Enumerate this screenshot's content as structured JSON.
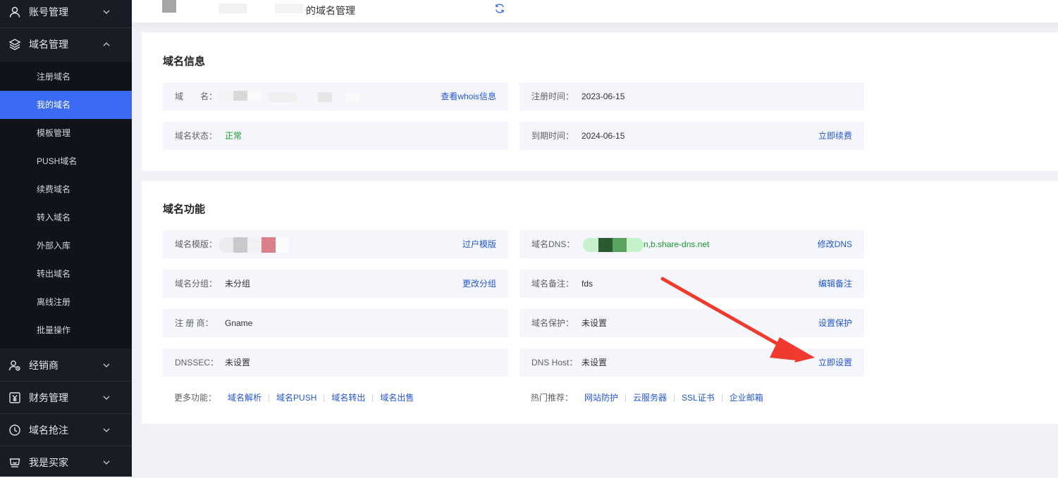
{
  "sidebar": {
    "groups": [
      {
        "label": "账号管理",
        "icon": "user-icon",
        "expanded": false
      },
      {
        "label": "域名管理",
        "icon": "layers-icon",
        "expanded": true
      },
      {
        "label": "经销商",
        "icon": "dealer-icon",
        "expanded": false
      },
      {
        "label": "财务管理",
        "icon": "finance-icon",
        "expanded": false
      },
      {
        "label": "域名抢注",
        "icon": "clock-icon",
        "expanded": false
      },
      {
        "label": "我是买家",
        "icon": "cart-icon",
        "expanded": false
      }
    ],
    "subitems": [
      {
        "label": "注册域名",
        "active": false
      },
      {
        "label": "我的域名",
        "active": true
      },
      {
        "label": "模板管理",
        "active": false
      },
      {
        "label": "PUSH域名",
        "active": false
      },
      {
        "label": "续费域名",
        "active": false
      },
      {
        "label": "转入域名",
        "active": false
      },
      {
        "label": "外部入库",
        "active": false
      },
      {
        "label": "转出域名",
        "active": false
      },
      {
        "label": "离线注册",
        "active": false
      },
      {
        "label": "批量操作",
        "active": false
      }
    ]
  },
  "header": {
    "title": "的域名管理",
    "refresh_icon": "refresh-icon"
  },
  "info_card": {
    "title": "域名信息",
    "domain_label": "域　　名：",
    "whois_link": "查看whois信息",
    "reg_time_label": "注册时间：",
    "reg_time_value": "2023-06-15",
    "status_label": "域名状态：",
    "status_value": "正常",
    "expire_label": "到期时间：",
    "expire_value": "2024-06-15",
    "renew_link": "立即续费"
  },
  "func_card": {
    "title": "域名功能",
    "template_label": "域名模版：",
    "template_link": "过户模版",
    "dns_label": "域名DNS：",
    "dns_value": "n,b.share-dns.net",
    "dns_link": "修改DNS",
    "group_label": "域名分组：",
    "group_value": "未分组",
    "group_link": "更改分组",
    "remark_label": "域名备注：",
    "remark_value": "fds",
    "remark_link": "编辑备注",
    "registrar_label": "注 册 商：",
    "registrar_value": "Gname",
    "protect_label": "域名保护：",
    "protect_value": "未设置",
    "protect_link": "设置保护",
    "dnssec_label": "DNSSEC：",
    "dnssec_value": "未设置",
    "dnshost_label": "DNS Host：",
    "dnshost_value": "未设置",
    "dnshost_link": "立即设置",
    "more_label": "更多功能：",
    "more_links": [
      "域名解析",
      "域名PUSH",
      "域名转出",
      "域名出售"
    ],
    "hot_label": "热门推荐：",
    "hot_links": [
      "网站防护",
      "云服务器",
      "SSL证书",
      "企业邮箱"
    ]
  },
  "colors": {
    "sidebar_bg": "#191c25",
    "submenu_bg": "#11131a",
    "active": "#3b6bf5",
    "link": "#2456d6",
    "ok_green": "#1a9a2c",
    "arrow": "#f03a2e"
  }
}
